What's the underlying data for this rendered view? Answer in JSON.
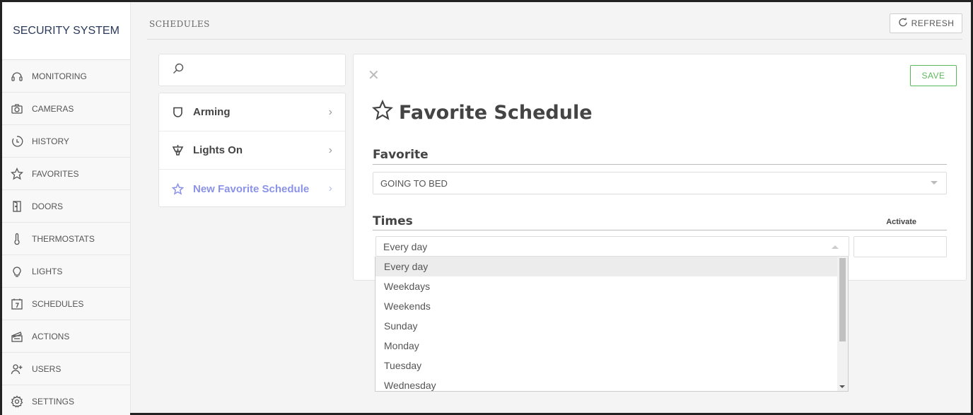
{
  "sidebar": {
    "brand": "SECURITY SYSTEM",
    "items": [
      {
        "label": "MONITORING",
        "icon": "headset-icon"
      },
      {
        "label": "CAMERAS",
        "icon": "camera-icon"
      },
      {
        "label": "HISTORY",
        "icon": "history-icon"
      },
      {
        "label": "FAVORITES",
        "icon": "star-icon"
      },
      {
        "label": "DOORS",
        "icon": "door-icon"
      },
      {
        "label": "THERMOSTATS",
        "icon": "thermometer-icon"
      },
      {
        "label": "LIGHTS",
        "icon": "bulb-icon"
      },
      {
        "label": "SCHEDULES",
        "icon": "calendar-icon"
      },
      {
        "label": "ACTIONS",
        "icon": "clapper-icon"
      },
      {
        "label": "USERS",
        "icon": "users-icon"
      },
      {
        "label": "SETTINGS",
        "icon": "gear-icon"
      }
    ]
  },
  "header": {
    "title": "SCHEDULES",
    "refresh_label": "REFRESH"
  },
  "search": {
    "placeholder": ""
  },
  "schedule_list": [
    {
      "label": "Arming",
      "icon": "shield-icon"
    },
    {
      "label": "Lights On",
      "icon": "lamp-icon"
    },
    {
      "label": "New Favorite Schedule",
      "icon": "star-icon",
      "active": true
    }
  ],
  "detail": {
    "save_label": "SAVE",
    "title": "Favorite Schedule",
    "favorite_section": "Favorite",
    "favorite_value": "GOING TO BED",
    "times_section": "Times",
    "activate_label": "Activate",
    "times_value": "Every day",
    "activate_value": ""
  },
  "dropdown_options": [
    "Every day",
    "Weekdays",
    "Weekends",
    "Sunday",
    "Monday",
    "Tuesday",
    "Wednesday"
  ],
  "colors": {
    "accent_active": "#8b93e8",
    "save_green": "#5cb85c",
    "brand_text": "#2b3a5a"
  }
}
